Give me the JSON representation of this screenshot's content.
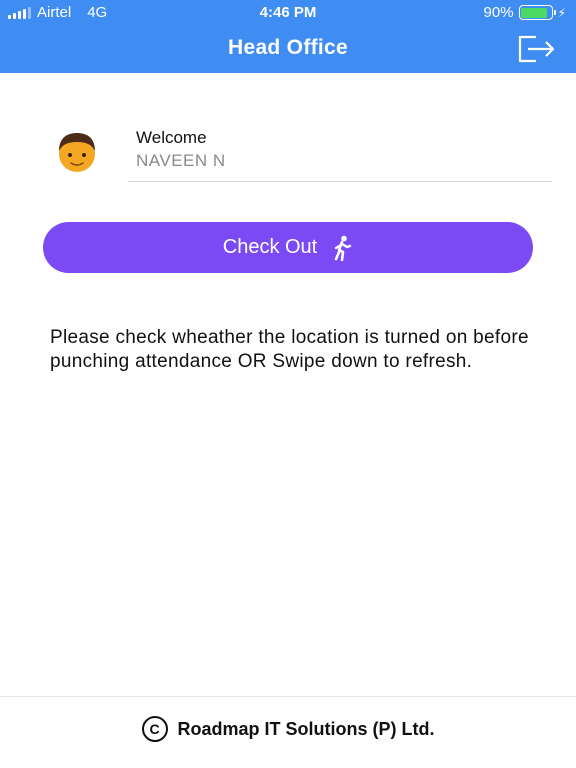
{
  "status_bar": {
    "carrier": "Airtel",
    "network": "4G",
    "time": "4:46 PM",
    "battery_text": "90%",
    "battery_level": 0.9,
    "battery_color": "#4cd964"
  },
  "navbar": {
    "title": "Head Office",
    "logout_icon": "logout-icon",
    "color": "#3f8df2"
  },
  "welcome": {
    "label": "Welcome",
    "user_name": "NAVEEN N",
    "avatar_icon": "boy-face-icon"
  },
  "checkout": {
    "label": "Check Out",
    "icon": "walking-person-icon",
    "color": "#7b4af5"
  },
  "info": {
    "message": "Please check wheather the location is turned on before punching attendance OR Swipe down to refresh."
  },
  "footer": {
    "copyright_symbol": "C",
    "company": "Roadmap IT Solutions (P) Ltd."
  }
}
